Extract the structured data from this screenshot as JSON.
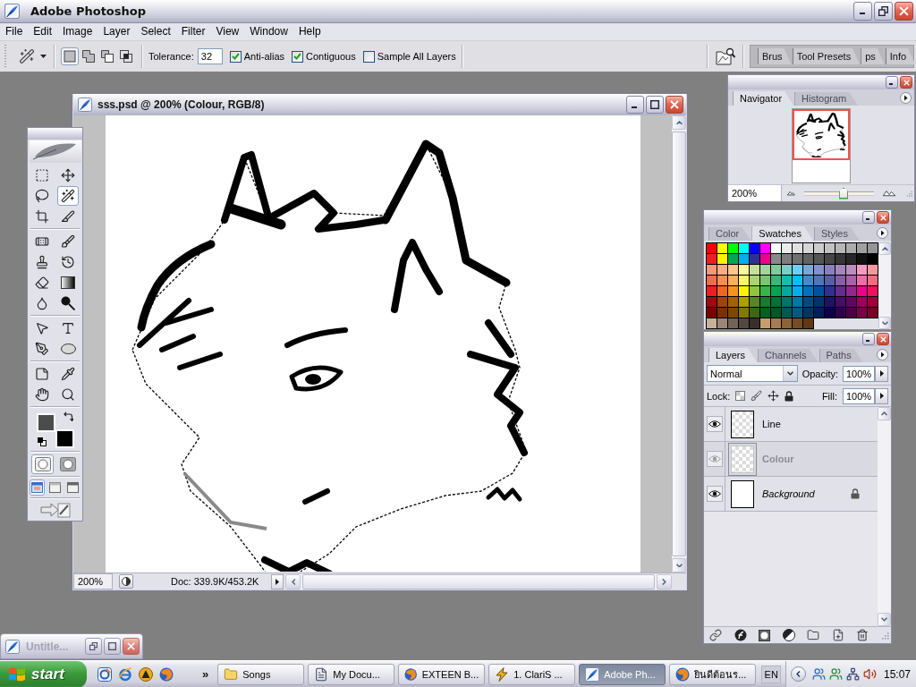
{
  "window": {
    "title": "Adobe Photoshop"
  },
  "menu": [
    "File",
    "Edit",
    "Image",
    "Layer",
    "Select",
    "Filter",
    "View",
    "Window",
    "Help"
  ],
  "options_bar": {
    "selection_modes": [
      {
        "selected": true
      },
      {
        "selected": false
      },
      {
        "selected": false
      },
      {
        "selected": false
      }
    ],
    "tolerance": {
      "label": "Tolerance:",
      "value": "32"
    },
    "checkboxes": [
      {
        "label": "Anti-alias",
        "checked": true
      },
      {
        "label": "Contiguous",
        "checked": true
      },
      {
        "label": "Sample All Layers",
        "checked": false
      }
    ],
    "palette_well_tabs": [
      "Brus",
      "Tool Presets",
      "ps",
      "Info"
    ]
  },
  "toolbox": {
    "tools": [
      {
        "selected": false
      },
      {
        "selected": false
      },
      {
        "selected": false
      },
      {
        "selected": true
      },
      {
        "selected": false
      },
      {
        "selected": false
      },
      {
        "selected": false
      },
      {
        "selected": false
      },
      {
        "selected": false
      },
      {
        "selected": false
      },
      {
        "selected": false
      },
      {
        "selected": false
      },
      {
        "selected": false
      },
      {
        "selected": false
      },
      {
        "selected": false
      },
      {
        "selected": false
      },
      {
        "selected": false
      },
      {
        "selected": false
      },
      {
        "selected": false
      },
      {
        "selected": false
      },
      {
        "selected": false
      },
      {
        "selected": false
      }
    ],
    "colors": [
      {
        "color": "#4c4c4c"
      },
      {
        "color": "#000000"
      }
    ],
    "mask_modes": [
      {
        "selected": true
      },
      {
        "selected": false
      }
    ],
    "screen_modes": [
      {
        "selected": true
      },
      {
        "selected": false
      },
      {
        "selected": false
      }
    ]
  },
  "document": {
    "title": "sss.psd @ 200% (Colour, RGB/8)",
    "zoom": "200%",
    "status": "Doc: 339.9K/453.2K"
  },
  "navigator": {
    "tabs": [
      {
        "label": "Navigator",
        "selected": true
      },
      {
        "label": "Histogram",
        "selected": false
      }
    ],
    "zoom": "200%",
    "zoom_slider": {
      "level": 0.58
    }
  },
  "swatches_panel": {
    "tabs": [
      {
        "label": "Color",
        "selected": false
      },
      {
        "label": "Swatches",
        "selected": true
      },
      {
        "label": "Styles",
        "selected": false
      }
    ],
    "swatches": [
      {
        "color": "#ff0000"
      },
      {
        "color": "#ffff00"
      },
      {
        "color": "#00ff00"
      },
      {
        "color": "#00ffff"
      },
      {
        "color": "#0000ff"
      },
      {
        "color": "#ff00ff"
      },
      {
        "color": "#ffffff"
      },
      {
        "color": "#ebebeb"
      },
      {
        "color": "#e1e1e1"
      },
      {
        "color": "#d7d7d7"
      },
      {
        "color": "#cccccc"
      },
      {
        "color": "#c2c2c2"
      },
      {
        "color": "#b7b7b7"
      },
      {
        "color": "#acacac"
      },
      {
        "color": "#a0a0a0"
      },
      {
        "color": "#959595"
      },
      {
        "color": "#ee1d24"
      },
      {
        "color": "#fff100"
      },
      {
        "color": "#00a650"
      },
      {
        "color": "#00aeef"
      },
      {
        "color": "#2f3192"
      },
      {
        "color": "#ed008c"
      },
      {
        "color": "#898989"
      },
      {
        "color": "#7d7d7d"
      },
      {
        "color": "#707070"
      },
      {
        "color": "#626262"
      },
      {
        "color": "#555555"
      },
      {
        "color": "#464646"
      },
      {
        "color": "#363636"
      },
      {
        "color": "#262626"
      },
      {
        "color": "#111111"
      },
      {
        "color": "#000000"
      },
      {
        "color": "#f7977a"
      },
      {
        "color": "#fbad82"
      },
      {
        "color": "#fdc68c"
      },
      {
        "color": "#fff799"
      },
      {
        "color": "#c6df9c"
      },
      {
        "color": "#a4d49d"
      },
      {
        "color": "#81ca9d"
      },
      {
        "color": "#7bcdc9"
      },
      {
        "color": "#6ccff7"
      },
      {
        "color": "#7ca6d8"
      },
      {
        "color": "#8293ca"
      },
      {
        "color": "#8881be"
      },
      {
        "color": "#a286bd"
      },
      {
        "color": "#bc8cbf"
      },
      {
        "color": "#f49bc1"
      },
      {
        "color": "#f5999d"
      },
      {
        "color": "#f16c4d"
      },
      {
        "color": "#f68e54"
      },
      {
        "color": "#fbaf5a"
      },
      {
        "color": "#fff467"
      },
      {
        "color": "#acd372"
      },
      {
        "color": "#7dc473"
      },
      {
        "color": "#39b778"
      },
      {
        "color": "#16bcb4"
      },
      {
        "color": "#00bff3"
      },
      {
        "color": "#438ccb"
      },
      {
        "color": "#5573b7"
      },
      {
        "color": "#5e5ca7"
      },
      {
        "color": "#855fa8"
      },
      {
        "color": "#a763a9"
      },
      {
        "color": "#ef6ea8"
      },
      {
        "color": "#f16d7e"
      },
      {
        "color": "#ee1d24"
      },
      {
        "color": "#f16522"
      },
      {
        "color": "#f7941d"
      },
      {
        "color": "#fff100"
      },
      {
        "color": "#8fc63d"
      },
      {
        "color": "#37b44a"
      },
      {
        "color": "#00a650"
      },
      {
        "color": "#00a99e"
      },
      {
        "color": "#00aeef"
      },
      {
        "color": "#0072bc"
      },
      {
        "color": "#0054a5"
      },
      {
        "color": "#2f3192"
      },
      {
        "color": "#652c91"
      },
      {
        "color": "#91278f"
      },
      {
        "color": "#ed008c"
      },
      {
        "color": "#ee105a"
      },
      {
        "color": "#9d0a0f"
      },
      {
        "color": "#a1410d"
      },
      {
        "color": "#a36209"
      },
      {
        "color": "#aba000"
      },
      {
        "color": "#588528"
      },
      {
        "color": "#197b30"
      },
      {
        "color": "#007236"
      },
      {
        "color": "#00736a"
      },
      {
        "color": "#0076a4"
      },
      {
        "color": "#004a80"
      },
      {
        "color": "#003370"
      },
      {
        "color": "#1d1363"
      },
      {
        "color": "#450e61"
      },
      {
        "color": "#62055f"
      },
      {
        "color": "#9e005c"
      },
      {
        "color": "#9d0039"
      },
      {
        "color": "#790000"
      },
      {
        "color": "#7b3000"
      },
      {
        "color": "#7c4900"
      },
      {
        "color": "#827a00"
      },
      {
        "color": "#3e6617"
      },
      {
        "color": "#045f20"
      },
      {
        "color": "#005824"
      },
      {
        "color": "#005951"
      },
      {
        "color": "#005b7e"
      },
      {
        "color": "#003562"
      },
      {
        "color": "#002056"
      },
      {
        "color": "#0c004b"
      },
      {
        "color": "#30004a"
      },
      {
        "color": "#4b0048"
      },
      {
        "color": "#7a0045"
      },
      {
        "color": "#7a0026"
      },
      {
        "color": "#c7b299"
      },
      {
        "color": "#998675"
      },
      {
        "color": "#736357"
      },
      {
        "color": "#534741"
      },
      {
        "color": "#37302d"
      },
      {
        "color": "#c69c6d"
      },
      {
        "color": "#a67c52"
      },
      {
        "color": "#8c6239"
      },
      {
        "color": "#754c24"
      },
      {
        "color": "#603813"
      }
    ]
  },
  "layers_panel": {
    "tabs": [
      {
        "label": "Layers",
        "selected": true
      },
      {
        "label": "Channels",
        "selected": false
      },
      {
        "label": "Paths",
        "selected": false
      }
    ],
    "blend_mode": "Normal",
    "opacity": {
      "label": "Opacity:",
      "value": "100%"
    },
    "lock_label": "Lock:",
    "fill": {
      "label": "Fill:",
      "value": "100%"
    },
    "layers": [
      {
        "name": "Line",
        "kind": "layer",
        "visible": true,
        "selected": false,
        "locked": false
      },
      {
        "name": "Colour",
        "kind": "layer",
        "visible": true,
        "selected": true,
        "locked": false
      },
      {
        "name": "Background",
        "kind": "background",
        "visible": true,
        "selected": false,
        "locked": true
      }
    ]
  },
  "minimized_window": {
    "title": "Untitle..."
  },
  "taskbar": {
    "start": "start",
    "overflow": "»",
    "tasks": [
      {
        "label": "Songs",
        "kind": "folder",
        "selected": false
      },
      {
        "label": "My Docu...",
        "kind": "document",
        "selected": false
      },
      {
        "label": "EXTEEN B...",
        "kind": "browser",
        "selected": false
      },
      {
        "label": "1. ClariS ...",
        "kind": "player",
        "selected": false
      },
      {
        "label": "Adobe Ph...",
        "kind": "photoshop",
        "selected": true
      },
      {
        "label": "ยินดีต้อนร...",
        "kind": "browser",
        "selected": false
      }
    ],
    "language": "EN",
    "clock": "15:07"
  }
}
